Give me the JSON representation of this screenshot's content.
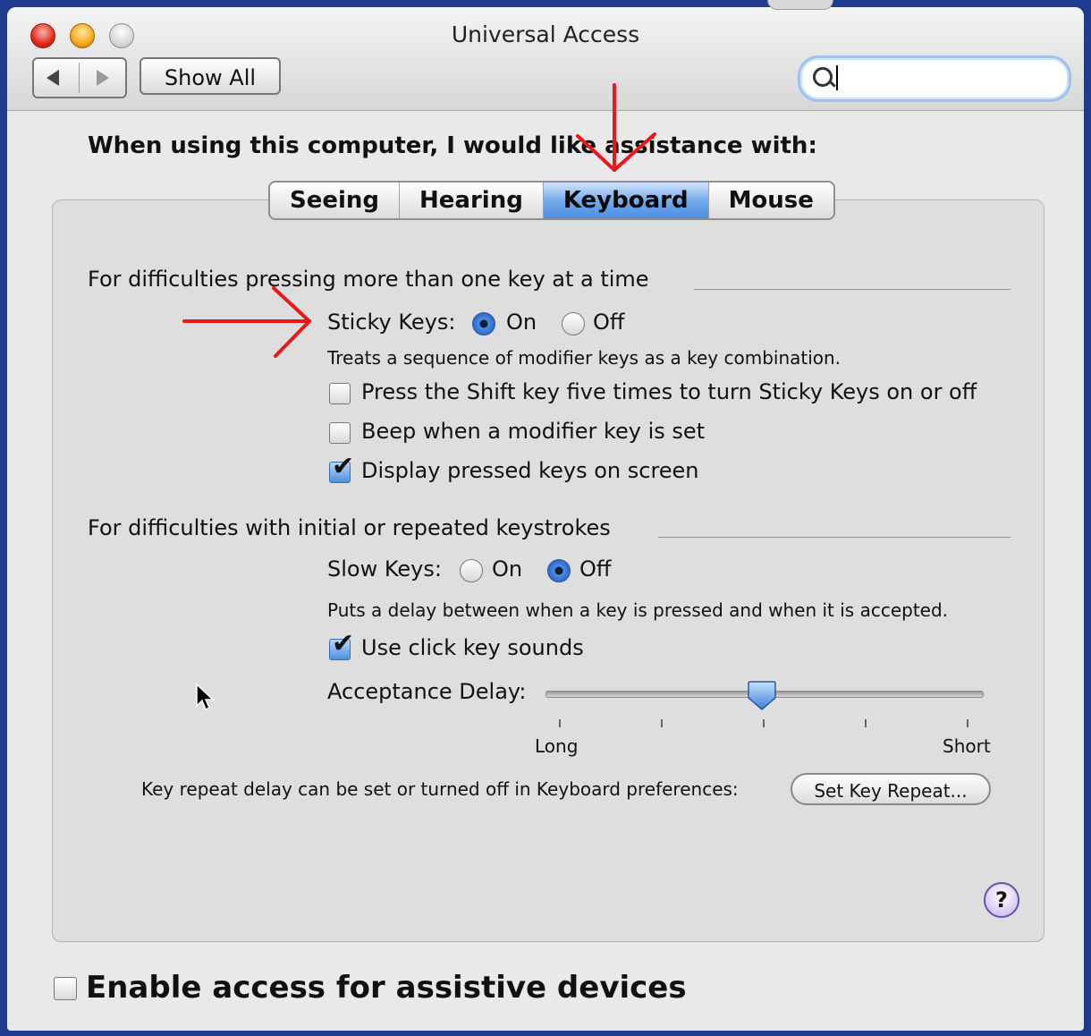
{
  "window": {
    "title": "Universal Access",
    "toolbar": {
      "show_all_label": "Show All"
    },
    "search": {
      "value": ""
    }
  },
  "heading": "When using this computer, I would like assistance with:",
  "tabs": [
    {
      "label": "Seeing",
      "active": false
    },
    {
      "label": "Hearing",
      "active": false
    },
    {
      "label": "Keyboard",
      "active": true
    },
    {
      "label": "Mouse",
      "active": false
    }
  ],
  "sticky_section": {
    "title": "For difficulties pressing more than one key at a time",
    "sticky_keys_label": "Sticky Keys:",
    "on_label": "On",
    "off_label": "Off",
    "selected": "On",
    "description": "Treats a sequence of modifier keys as a key combination.",
    "options": [
      {
        "label": "Press the Shift key five times to turn Sticky Keys on or off",
        "checked": false
      },
      {
        "label": "Beep when a modifier key is set",
        "checked": false
      },
      {
        "label": "Display pressed keys on screen",
        "checked": true
      }
    ]
  },
  "slow_section": {
    "title": "For difficulties with initial or repeated keystrokes",
    "slow_keys_label": "Slow Keys:",
    "on_label": "On",
    "off_label": "Off",
    "selected": "Off",
    "description": "Puts a delay between when a key is pressed and when it is accepted.",
    "click_sounds": {
      "label": "Use click key sounds",
      "checked": true
    },
    "acceptance_delay": {
      "label": "Acceptance Delay:",
      "min_label": "Long",
      "max_label": "Short",
      "value_fraction": 0.5
    },
    "key_repeat_text": "Key repeat delay can be set or turned off in Keyboard preferences:",
    "set_key_repeat_label": "Set Key Repeat..."
  },
  "help_label": "?",
  "assistive": {
    "label": "Enable access for assistive devices",
    "checked": false
  },
  "colors": {
    "accent_blue": "#4d8fe0",
    "annotation_red": "#e8191d"
  }
}
